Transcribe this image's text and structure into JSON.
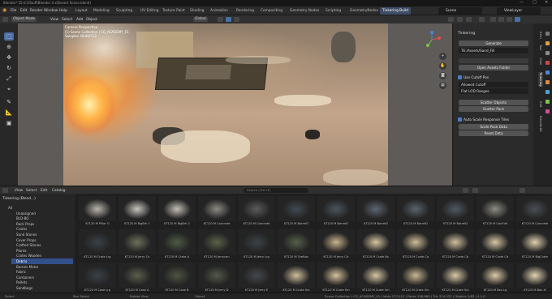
{
  "titlebar": {
    "title": "Blender* [D:\\CGStuff\\Blender 4.x\\Desert Scene.blend]",
    "minimize": "—",
    "maximize": "□",
    "close": "✕"
  },
  "menubar": {
    "items": [
      "File",
      "Edit",
      "Render",
      "Window",
      "Help"
    ],
    "workspaces": [
      "Layout",
      "Modeling",
      "Sculpting",
      "UV Editing",
      "Texture Paint",
      "Shading",
      "Animation",
      "Rendering",
      "Compositing",
      "Geometry Nodes",
      "Scripting",
      "GeometryNodes",
      "Tinkering Build"
    ],
    "active_workspace_index": 12,
    "scene": "Scene",
    "view_layer": "ViewLayer"
  },
  "viewport_header": {
    "mode": "Object Mode",
    "menus": [
      "View",
      "Select",
      "Add",
      "Object"
    ],
    "transform": "Global"
  },
  "viewport_hud": {
    "line1": "Camera Perspective",
    "line2": "(1) Scene Collection | CG_ACADEMY_01",
    "line3": "Samples 40/40/512"
  },
  "n_panel": {
    "title": "Tinkering",
    "generate_btn": "Generate",
    "field1": "TE:/Assets/Sand_Fill",
    "btn2": "Open Assets Folder",
    "check1": "Use Cutoff Pos",
    "field2": "Allowed Cutoff",
    "field3": "Flat LOD Ranges",
    "btn_scatter1": "Scatter Objects",
    "btn_scatter2": "Scatter Pack",
    "check2": "Auto Scale Response Tiles",
    "btn_a": "Scale Pack Data",
    "btn_b": "Reset Data"
  },
  "vtabs": [
    "Item",
    "Tool",
    "View",
    "Tinkering",
    "Edit",
    "BlenderKit"
  ],
  "asset_browser": {
    "header_menus": [
      "View",
      "Select",
      "Edit",
      "Catalog"
    ],
    "search_placeholder": "Search (Ctrl+F)",
    "library_label": "Tinkering (Blend...)",
    "tree": [
      "All",
      "Unassigned",
      "BLD-BO",
      "Rock Props",
      "Crates",
      "Sand Stones",
      "Cover Props",
      "Crafted Stones",
      "Plants",
      "Crates Wooden",
      "Debris",
      "Barrels Metal",
      "Fabric",
      "Containers",
      "Pallets",
      "Sandbags"
    ],
    "selected_tree_index": 10,
    "assets": [
      "KT120 M Pillar G",
      "KT120 M BigBrk 1",
      "KT120 M BigBrk 2",
      "KT120 M Concrete",
      "KT120 M Concrete",
      "KT120 M BarrelD",
      "KT120 M BarrelD",
      "KT120 M BarrelD",
      "KT120 M BarrelD",
      "KT120 M BarrelD",
      "KT120 M CanFlat",
      "KT120 M Concrete",
      "KT120 M Crate Lrg",
      "KT120 M Jerry Cn",
      "KT120 M Crate A",
      "KT120 M Jerrycan",
      "KT120 M Jerry Lrg",
      "KT120 M OreBox",
      "KT120 M Jerry Crt",
      "KT120 M Crate Bx",
      "KT120 M Crate Ca",
      "KT120 M Crate Cb",
      "KT120 M Crate Cd",
      "KT120 M BigCrate",
      "KT120 M Case Lrg",
      "KT120 M Case A",
      "KT120 M Case B",
      "KT120 M Jerry D",
      "KT120 M Jerry E",
      "KT120 M Crate Sm",
      "KT120 M Crate Sm",
      "KT120 M Crate Sm",
      "KT120 M Crate Sm",
      "KT120 M Crate Sm",
      "KT120 M Box Lg",
      "KT120 M Box Xl"
    ]
  },
  "statusbar": {
    "left": "Select",
    "mid1": "Box Select",
    "mid2": "Rotate View",
    "mid3": "Object",
    "right": "Scene Collection | CG_ACADEMY_01 | Verts 177,412 | Faces 158,880 | Tris 314,032 | Objects 1/83 | 4.1.0"
  },
  "colors": {
    "accent": "#4a6fa5",
    "selected": "#33508a",
    "panel_bg": "#2b2b2b"
  }
}
